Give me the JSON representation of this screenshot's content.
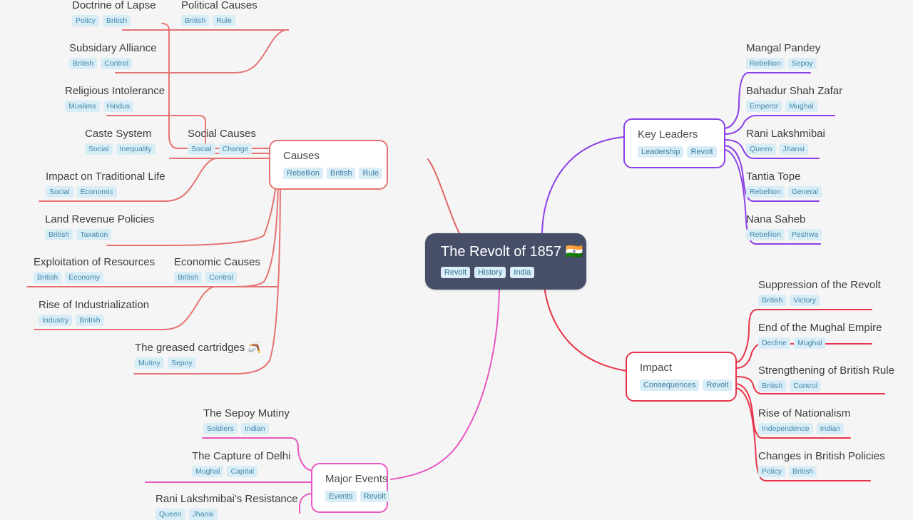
{
  "background_color": "#f5f5f5",
  "colors": {
    "root_bg": "#474e68",
    "causes": "#e57373",
    "key_leaders": "#8b3fe8",
    "impact": "#e8344a",
    "major_events": "#e857c3",
    "tag_bg": "#d9edf7",
    "tag_text": "#3c7ea1"
  },
  "root": {
    "title": "The Revolt of 1857 🇮🇳",
    "tags": [
      "Revolt",
      "History",
      "India"
    ]
  },
  "branches": [
    {
      "id": "causes",
      "label": "Causes",
      "tags": [
        "Rebellion",
        "British",
        "Rule"
      ],
      "color": "#e57373"
    },
    {
      "id": "key-leaders",
      "label": "Key Leaders",
      "tags": [
        "Leadership",
        "Revolt"
      ],
      "color": "#8b3fe8"
    },
    {
      "id": "impact",
      "label": "Impact",
      "tags": [
        "Consequences",
        "Revolt"
      ],
      "color": "#e8344a"
    },
    {
      "id": "major-events",
      "label": "Major Events",
      "tags": [
        "Events",
        "Revolt"
      ],
      "color": "#e857c3"
    }
  ],
  "causes_children": {
    "political": {
      "label": "Political Causes",
      "tags": [
        "British",
        "Rule"
      ],
      "children": [
        {
          "label": "Doctrine of Lapse",
          "tags": [
            "Policy",
            "British"
          ]
        },
        {
          "label": "Subsidary Alliance",
          "tags": [
            "British",
            "Control"
          ]
        }
      ]
    },
    "religious": {
      "label": "Religious Intolerance",
      "tags": [
        "Muslims",
        "Hindus"
      ]
    },
    "social": {
      "label": "Social Causes",
      "tags": [
        "Social",
        "Change"
      ],
      "children": [
        {
          "label": "Caste System",
          "tags": [
            "Social",
            "Inequality"
          ]
        },
        {
          "label": "Impact on Traditional Life",
          "tags": [
            "Social",
            "Economic"
          ]
        }
      ]
    },
    "land_revenue": {
      "label": "Land Revenue Policies",
      "tags": [
        "British",
        "Taxation"
      ]
    },
    "economic": {
      "label": "Economic Causes",
      "tags": [
        "British",
        "Control"
      ],
      "children": [
        {
          "label": "Exploitation of Resources",
          "tags": [
            "British",
            "Economy"
          ]
        },
        {
          "label": "Rise of Industrialization",
          "tags": [
            "Industry",
            "British"
          ]
        }
      ]
    },
    "cartridges": {
      "label": "The greased cartridges 🪃",
      "tags": [
        "Mutiny",
        "Sepoy"
      ]
    }
  },
  "key_leaders_children": [
    {
      "label": "Mangal Pandey",
      "tags": [
        "Rebellion",
        "Sepoy"
      ]
    },
    {
      "label": "Bahadur Shah Zafar",
      "tags": [
        "Emperor",
        "Mughal"
      ]
    },
    {
      "label": "Rani Lakshmibai",
      "tags": [
        "Queen",
        "Jhansi"
      ]
    },
    {
      "label": "Tantia Tope",
      "tags": [
        "Rebellion",
        "General"
      ]
    },
    {
      "label": "Nana Saheb",
      "tags": [
        "Rebellion",
        "Peshwa"
      ]
    }
  ],
  "impact_children": [
    {
      "label": "Suppression of the Revolt",
      "tags": [
        "British",
        "Victory"
      ]
    },
    {
      "label": "End of the Mughal Empire",
      "tags": [
        "Decline",
        "Mughal"
      ]
    },
    {
      "label": "Strengthening of British Rule",
      "tags": [
        "British",
        "Control"
      ]
    },
    {
      "label": "Rise of Nationalism",
      "tags": [
        "Independence",
        "Indian"
      ]
    },
    {
      "label": "Changes in British Policies",
      "tags": [
        "Policy",
        "British"
      ]
    }
  ],
  "major_events_children": [
    {
      "label": "The Sepoy Mutiny",
      "tags": [
        "Soldiers",
        "Indian"
      ]
    },
    {
      "label": "The Capture of Delhi",
      "tags": [
        "Mughal",
        "Capital"
      ]
    },
    {
      "label": "Rani Lakshmibai's Resistance",
      "tags": [
        "Queen",
        "Jhansi"
      ]
    }
  ]
}
